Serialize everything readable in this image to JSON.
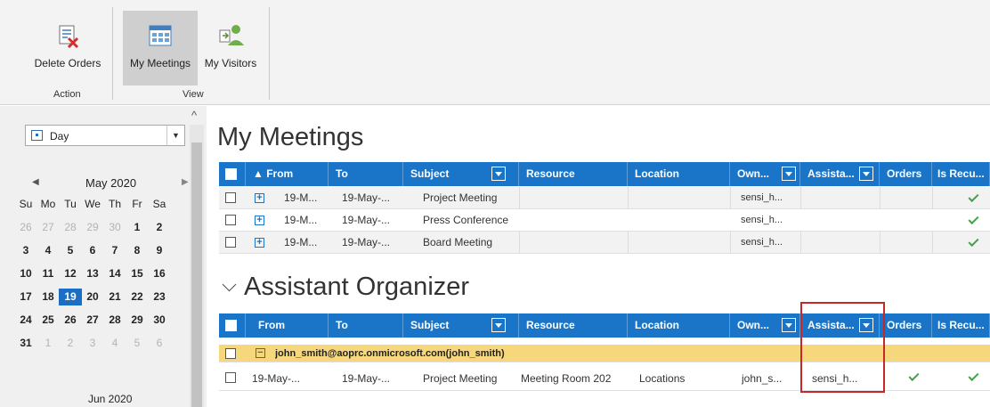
{
  "ribbon": {
    "delete_orders": "Delete Orders",
    "my_meetings": "My Meetings",
    "my_visitors": "My Visitors",
    "group_action": "Action",
    "group_view": "View"
  },
  "left": {
    "view_value": "Day",
    "calendar": {
      "month": "May 2020",
      "weekdays": [
        "Su",
        "Mo",
        "Tu",
        "We",
        "Th",
        "Fr",
        "Sa"
      ],
      "weeks": [
        [
          "26",
          "27",
          "28",
          "29",
          "30",
          "1",
          "2"
        ],
        [
          "3",
          "4",
          "5",
          "6",
          "7",
          "8",
          "9"
        ],
        [
          "10",
          "11",
          "12",
          "13",
          "14",
          "15",
          "16"
        ],
        [
          "17",
          "18",
          "19",
          "20",
          "21",
          "22",
          "23"
        ],
        [
          "24",
          "25",
          "26",
          "27",
          "28",
          "29",
          "30"
        ],
        [
          "31",
          "1",
          "2",
          "3",
          "4",
          "5",
          "6"
        ]
      ],
      "selected": "19",
      "next_month": "Jun 2020"
    }
  },
  "my_meetings": {
    "title": "My Meetings",
    "headers": {
      "from": "▲ From",
      "to": "To",
      "subject": "Subject",
      "resource": "Resource",
      "location": "Location",
      "owner": "Own...",
      "assistant": "Assista...",
      "orders": "Orders",
      "recurring": "Is Recu..."
    },
    "rows": [
      {
        "from": "19-M...",
        "to": "19-May-...",
        "subject": "Project Meeting",
        "owner": "sensi_h..."
      },
      {
        "from": "19-M...",
        "to": "19-May-...",
        "subject": "Press Conference",
        "owner": "sensi_h..."
      },
      {
        "from": "19-M...",
        "to": "19-May-...",
        "subject": "Board Meeting",
        "owner": "sensi_h..."
      }
    ]
  },
  "assistant_organizer": {
    "title": "Assistant Organizer",
    "headers": {
      "from": "From",
      "to": "To",
      "subject": "Subject",
      "resource": "Resource",
      "location": "Location",
      "owner": "Own...",
      "assistant": "Assista...",
      "orders": "Orders",
      "recurring": "Is Recu..."
    },
    "group": "john_smith@aoprc.onmicrosoft.com(john_smith)",
    "rows": [
      {
        "from": "19-May-...",
        "to": "19-May-...",
        "subject": "Project Meeting",
        "resource": "Meeting Room 202",
        "location": "Locations",
        "owner": "john_s...",
        "assistant": "sensi_h..."
      }
    ]
  },
  "colors": {
    "header_blue": "#1a74c7",
    "group_yellow": "#f7d77c",
    "check_green": "#43a047",
    "highlight_red": "#c62828",
    "today_blue": "#1a6fc4"
  }
}
